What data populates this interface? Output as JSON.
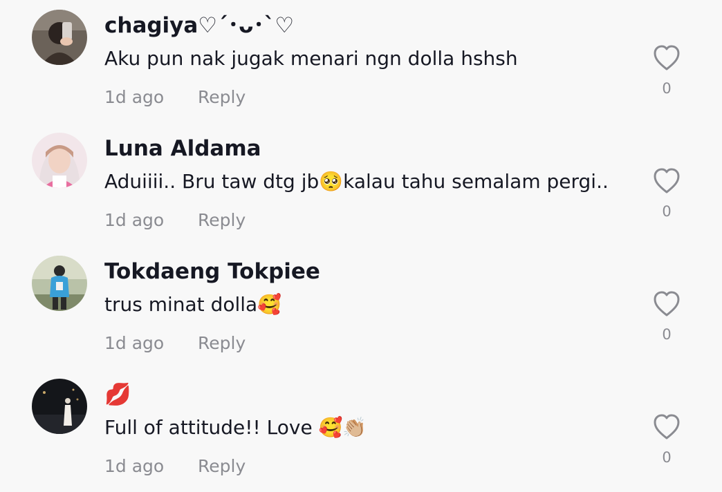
{
  "comments": [
    {
      "username": "chagiya♡´･ᴗ･`♡",
      "text": "Aku pun nak jugak menari ngn dolla hshsh",
      "time": "1d ago",
      "reply_label": "Reply",
      "likes": "0"
    },
    {
      "username": "Luna Aldama",
      "text": "Aduiiii.. Bru taw dtg jb🥺kalau tahu semalam pergi..",
      "time": "1d ago",
      "reply_label": "Reply",
      "likes": "0"
    },
    {
      "username": "Tokdaeng Tokpiee",
      "text": "trus minat dolla🥰",
      "time": "1d ago",
      "reply_label": "Reply",
      "likes": "0"
    },
    {
      "username": "💋",
      "text": "Full of attitude!! Love 🥰👏🏼",
      "time": "1d ago",
      "reply_label": "Reply",
      "likes": "0"
    }
  ],
  "icons": {
    "like": "heart-outline-icon"
  },
  "colors": {
    "background": "#f8f8f8",
    "username": "#161823",
    "secondary_text": "#8a8b91"
  }
}
